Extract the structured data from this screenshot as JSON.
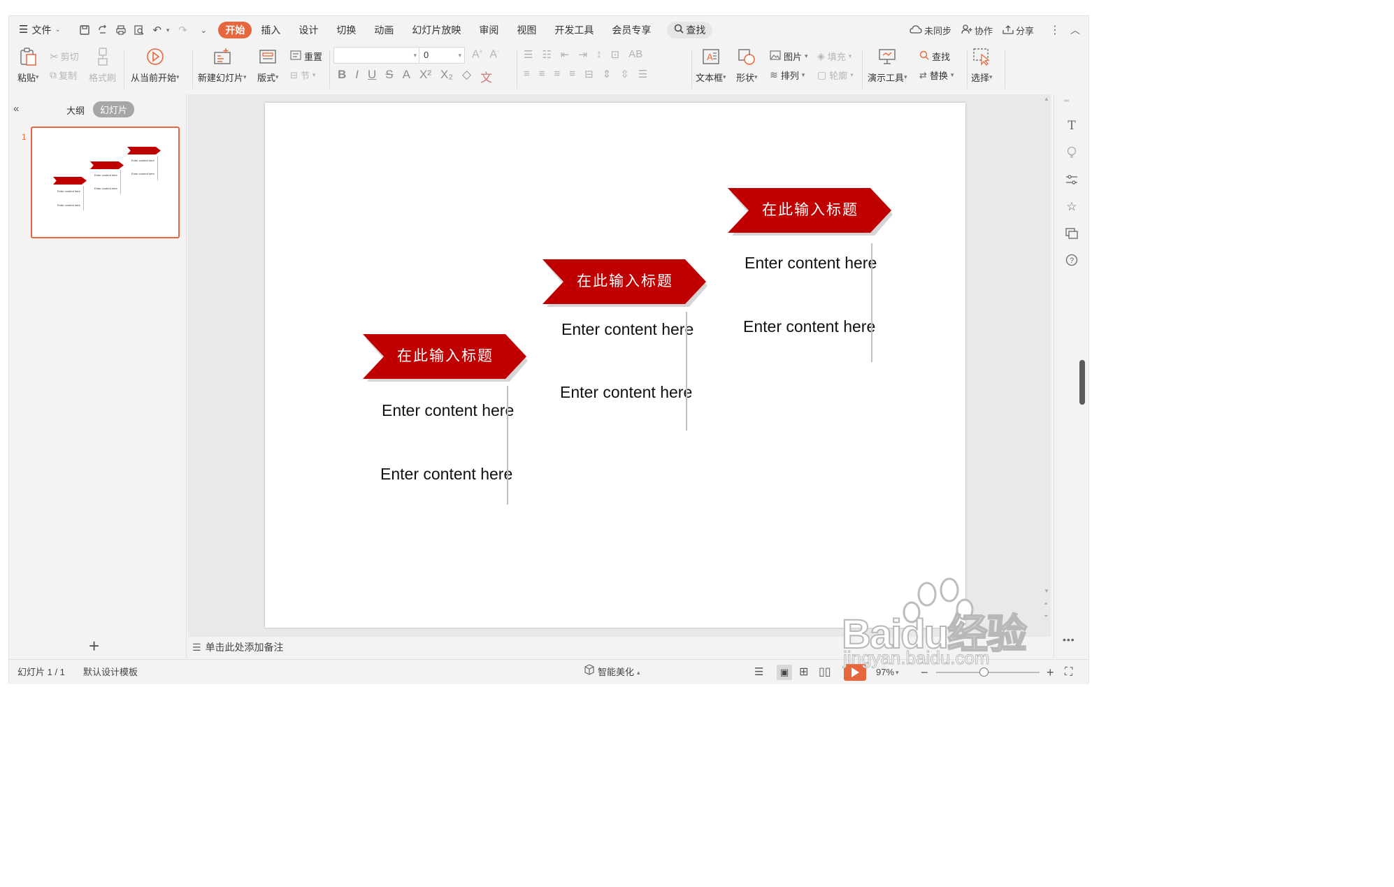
{
  "menubar": {
    "file_label": "文件",
    "tabs": [
      "开始",
      "插入",
      "设计",
      "切换",
      "动画",
      "幻灯片放映",
      "审阅",
      "视图",
      "开发工具",
      "会员专享"
    ],
    "active_tab": "开始",
    "search_label": "查找",
    "right": {
      "sync_label": "未同步",
      "collab_label": "协作",
      "share_label": "分享"
    }
  },
  "ribbon": {
    "paste": "粘贴",
    "cut": "剪切",
    "copy": "复制",
    "format_painter": "格式刷",
    "play_from_current": "从当前开始",
    "new_slide": "新建幻灯片",
    "layout": "版式",
    "reset": "重置",
    "section": "节",
    "font_size_value": "0",
    "text_box": "文本框",
    "shape": "形状",
    "picture": "图片",
    "fill": "填充",
    "arrange": "排列",
    "outline": "轮廓",
    "presentation_tools": "演示工具",
    "find": "查找",
    "replace": "替换",
    "select": "选择"
  },
  "left_panel": {
    "outline_tab": "大纲",
    "slides_tab": "幻灯片",
    "slide_number": "1",
    "add_slide": "+"
  },
  "slide": {
    "columns": [
      {
        "title": "在此输入标题",
        "items": [
          "Enter content here",
          "Enter content here"
        ]
      },
      {
        "title": "在此输入标题",
        "items": [
          "Enter content here",
          "Enter content here"
        ]
      },
      {
        "title": "在此输入标题",
        "items": [
          "Enter content here",
          "Enter content here"
        ]
      }
    ],
    "accent_color": "#c00000"
  },
  "notes": {
    "placeholder": "单击此处添加备注"
  },
  "statusbar": {
    "slide_counter": "幻灯片 1 / 1",
    "template": "默认设计模板",
    "beautify": "智能美化",
    "zoom": "97%"
  },
  "watermark": {
    "brand": "Baidu经验",
    "url": "jingyan.baidu.com"
  }
}
